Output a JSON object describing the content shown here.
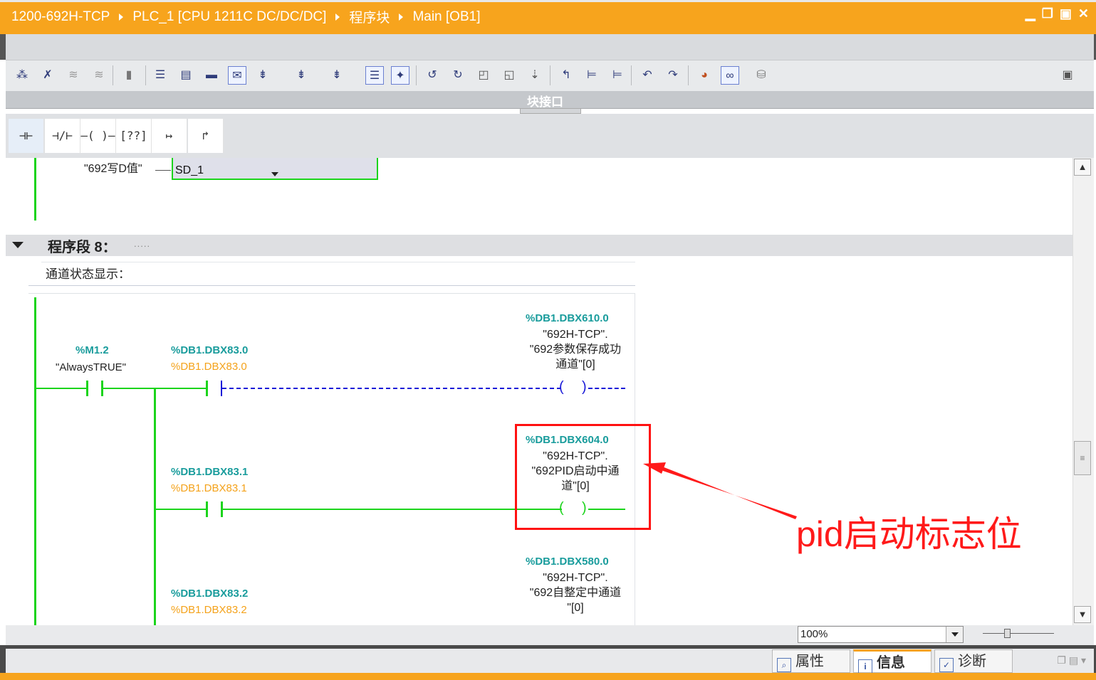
{
  "titlebar": {
    "crumbs": [
      "1200-692H-TCP",
      "PLC_1 [CPU 1211C DC/DC/DC]",
      "程序块",
      "Main [OB1]"
    ],
    "controls": [
      "▁",
      "❐",
      "▣",
      "✕"
    ]
  },
  "toolbar": {
    "icons": [
      "network-insert-icon",
      "network-delete-icon",
      "network-collapse-icon",
      "network-expand-icon",
      "absolute-operands-icon",
      "list-icon",
      "block-icon",
      "view-icon",
      "comment-icon",
      "favorites-icon",
      "monitor-icon",
      "compare-icon",
      "go-online-icon",
      "go-offline-icon",
      "download-icon",
      "upload-icon",
      "indent-icon",
      "outdent-icon",
      "breakpoint-icon",
      "step-icon",
      "call-icon",
      "monitoring-icon",
      "watch-icon",
      "layout-icon"
    ]
  },
  "interface_label": "块接口",
  "ladder_palette": [
    "⊣⊢",
    "⊣/⊢",
    "–( )–",
    "[??]",
    "↦",
    "↱"
  ],
  "top_fragment": {
    "param": "\"692写D值\"",
    "selector_value": "SD_1"
  },
  "network": {
    "title": "程序段 8：",
    "dots": ".....",
    "comment": "通道状态显示："
  },
  "contacts": [
    {
      "addr": "%M1.2",
      "sym": "\"AlwaysTRUE\""
    },
    {
      "addr": "%DB1.DBX83.0",
      "value": "%DB1.DBX83.0"
    },
    {
      "addr": "%DB1.DBX83.1",
      "value": "%DB1.DBX83.1"
    },
    {
      "addr": "%DB1.DBX83.2",
      "value": "%DB1.DBX83.2"
    }
  ],
  "coils": [
    {
      "addr": "%DB1.DBX610.0",
      "l1": "\"692H-TCP\".",
      "l2": "\"692参数保存成功",
      "l3": "通道\"[0]"
    },
    {
      "addr": "%DB1.DBX604.0",
      "l1": "\"692H-TCP\".",
      "l2": "\"692PID启动中通",
      "l3": "道\"[0]"
    },
    {
      "addr": "%DB1.DBX580.0",
      "l1": "\"692H-TCP\".",
      "l2": "\"692自整定中通道",
      "l3": "\"[0]"
    }
  ],
  "annotation": "pid启动标志位",
  "zoom": {
    "value": "100%"
  },
  "bottom_tabs": [
    {
      "label": "属性",
      "icon": "properties-icon"
    },
    {
      "label": "信息",
      "icon": "info-icon"
    },
    {
      "label": "诊断",
      "icon": "diagnostics-icon"
    }
  ],
  "colors": {
    "accent": "#f7a41d",
    "rung": "#1cd41c",
    "address": "#199c9c",
    "value": "#f4a21a",
    "annotation": "#ff1a1a"
  }
}
